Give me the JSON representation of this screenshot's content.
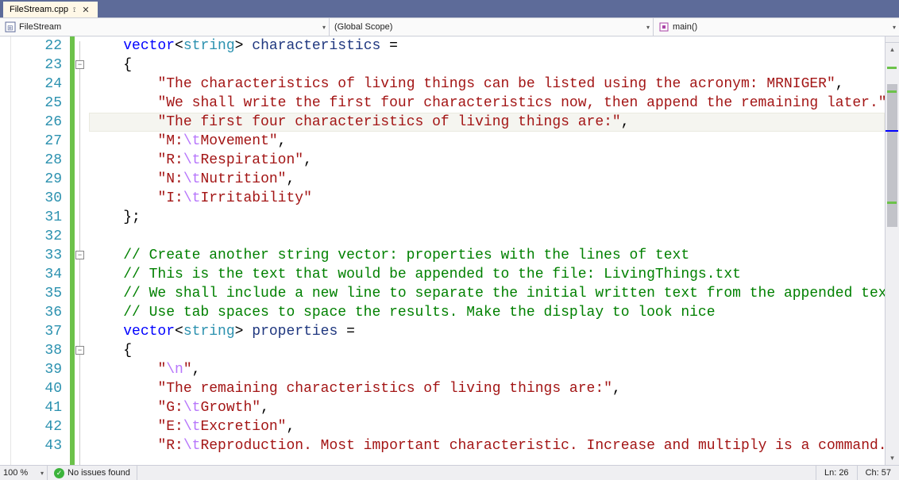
{
  "tab": {
    "title": "FileStream.cpp",
    "pinned": true
  },
  "dropdowns": {
    "left_icon": "cpp-file-icon",
    "left": "FileStream",
    "mid": "(Global Scope)",
    "right_icon": "method-icon",
    "right": "main()"
  },
  "gutter": {
    "start": 22,
    "end": 43
  },
  "outline": [
    {
      "line": 23,
      "sym": "−"
    },
    {
      "line": 33,
      "sym": "−"
    },
    {
      "line": 38,
      "sym": "−"
    }
  ],
  "current_line_index": 4,
  "code": [
    [
      [
        "kw",
        "vector"
      ],
      [
        "punct",
        "<"
      ],
      [
        "type",
        "string"
      ],
      [
        "punct",
        "> "
      ],
      [
        "ident",
        "characteristics"
      ],
      [
        "punct",
        " ="
      ]
    ],
    [
      [
        "punct",
        "{"
      ]
    ],
    [
      [
        "punct",
        "    "
      ],
      [
        "str",
        "\"The characteristics of living things can be listed using the acronym: MRNIGER\""
      ],
      [
        "punct",
        ","
      ]
    ],
    [
      [
        "punct",
        "    "
      ],
      [
        "str",
        "\"We shall write the first four characteristics now, then append the remaining later.\""
      ],
      [
        "punct",
        ","
      ]
    ],
    [
      [
        "punct",
        "    "
      ],
      [
        "str",
        "\"The first four characteristics of living things are:\""
      ],
      [
        "punct",
        ","
      ]
    ],
    [
      [
        "punct",
        "    "
      ],
      [
        "str",
        "\"M:"
      ],
      [
        "esc",
        "\\t"
      ],
      [
        "str",
        "Movement\""
      ],
      [
        "punct",
        ","
      ]
    ],
    [
      [
        "punct",
        "    "
      ],
      [
        "str",
        "\"R:"
      ],
      [
        "esc",
        "\\t"
      ],
      [
        "str",
        "Respiration\""
      ],
      [
        "punct",
        ","
      ]
    ],
    [
      [
        "punct",
        "    "
      ],
      [
        "str",
        "\"N:"
      ],
      [
        "esc",
        "\\t"
      ],
      [
        "str",
        "Nutrition\""
      ],
      [
        "punct",
        ","
      ]
    ],
    [
      [
        "punct",
        "    "
      ],
      [
        "str",
        "\"I:"
      ],
      [
        "esc",
        "\\t"
      ],
      [
        "str",
        "Irritability\""
      ]
    ],
    [
      [
        "punct",
        "};"
      ]
    ],
    [],
    [
      [
        "cmt",
        "// Create another string vector: properties with the lines of text"
      ]
    ],
    [
      [
        "cmt",
        "// This is the text that would be appended to the file: LivingThings.txt"
      ]
    ],
    [
      [
        "cmt",
        "// We shall include a new line to separate the initial written text from the appended text"
      ]
    ],
    [
      [
        "cmt",
        "// Use tab spaces to space the results. Make the display to look nice"
      ]
    ],
    [
      [
        "kw",
        "vector"
      ],
      [
        "punct",
        "<"
      ],
      [
        "type",
        "string"
      ],
      [
        "punct",
        "> "
      ],
      [
        "ident",
        "properties"
      ],
      [
        "punct",
        " ="
      ]
    ],
    [
      [
        "punct",
        "{"
      ]
    ],
    [
      [
        "punct",
        "    "
      ],
      [
        "str",
        "\""
      ],
      [
        "esc",
        "\\n"
      ],
      [
        "str",
        "\""
      ],
      [
        "punct",
        ","
      ]
    ],
    [
      [
        "punct",
        "    "
      ],
      [
        "str",
        "\"The remaining characteristics of living things are:\""
      ],
      [
        "punct",
        ","
      ]
    ],
    [
      [
        "punct",
        "    "
      ],
      [
        "str",
        "\"G:"
      ],
      [
        "esc",
        "\\t"
      ],
      [
        "str",
        "Growth\""
      ],
      [
        "punct",
        ","
      ]
    ],
    [
      [
        "punct",
        "    "
      ],
      [
        "str",
        "\"E:"
      ],
      [
        "esc",
        "\\t"
      ],
      [
        "str",
        "Excretion\""
      ],
      [
        "punct",
        ","
      ]
    ],
    [
      [
        "punct",
        "    "
      ],
      [
        "str",
        "\"R:"
      ],
      [
        "esc",
        "\\t"
      ],
      [
        "str",
        "Reproduction. Most important characteristic. Increase and multiply is a command.\""
      ],
      [
        "punct",
        ","
      ]
    ]
  ],
  "indent_cols": 4,
  "status": {
    "zoom": "100 %",
    "issues": "No issues found",
    "line_label": "Ln:",
    "line": "26",
    "col_label": "Ch:",
    "col": "57"
  }
}
